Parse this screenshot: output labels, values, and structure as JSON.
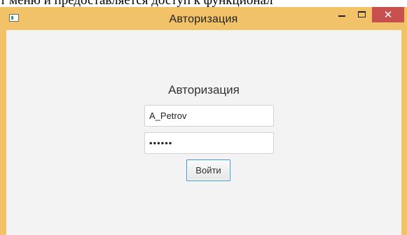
{
  "document": {
    "top_text": "т меню и предоставляется доступ к функционал"
  },
  "window": {
    "title": "Авторизация",
    "controls": {
      "minimize_icon": "minimize-icon",
      "maximize_icon": "maximize-icon",
      "close_symbol": "✕"
    },
    "accent_color": "#f1c267",
    "close_color": "#c7504f"
  },
  "form": {
    "heading": "Авторизация",
    "login": {
      "value": "A_Petrov"
    },
    "password": {
      "value": "••••••"
    },
    "submit_label": "Войти"
  }
}
